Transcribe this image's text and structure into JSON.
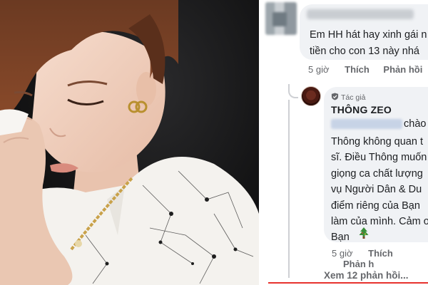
{
  "comment1": {
    "text_line1": "Em HH hát hay xinh gái n",
    "text_line2": "tiền cho con 13 này nhá",
    "time": "5 giờ",
    "like": "Thích",
    "reply": "Phản hồi"
  },
  "comment2": {
    "badge": "Tác giả",
    "author": "THÔNG ZEO",
    "first_line_tail": "chào",
    "lines": [
      "Thông không quan t",
      "sĩ. Điều Thông muốn",
      "giọng ca chất lượng",
      "vụ Người Dân & Du",
      "điểm riêng của Bạn",
      "làm của mình. Cảm ơ",
      "Bạn"
    ],
    "time": "5 giờ",
    "like": "Thích",
    "reply": "Phản h"
  },
  "view_replies": "Xem 12 phản hồi...",
  "icons": {
    "badge": "author-badge-icon",
    "tree": "christmas-tree-emoji"
  },
  "colors": {
    "bubble": "#f0f2f5",
    "text": "#1c1e21",
    "muted": "#65676b",
    "underline": "#e7312d"
  }
}
